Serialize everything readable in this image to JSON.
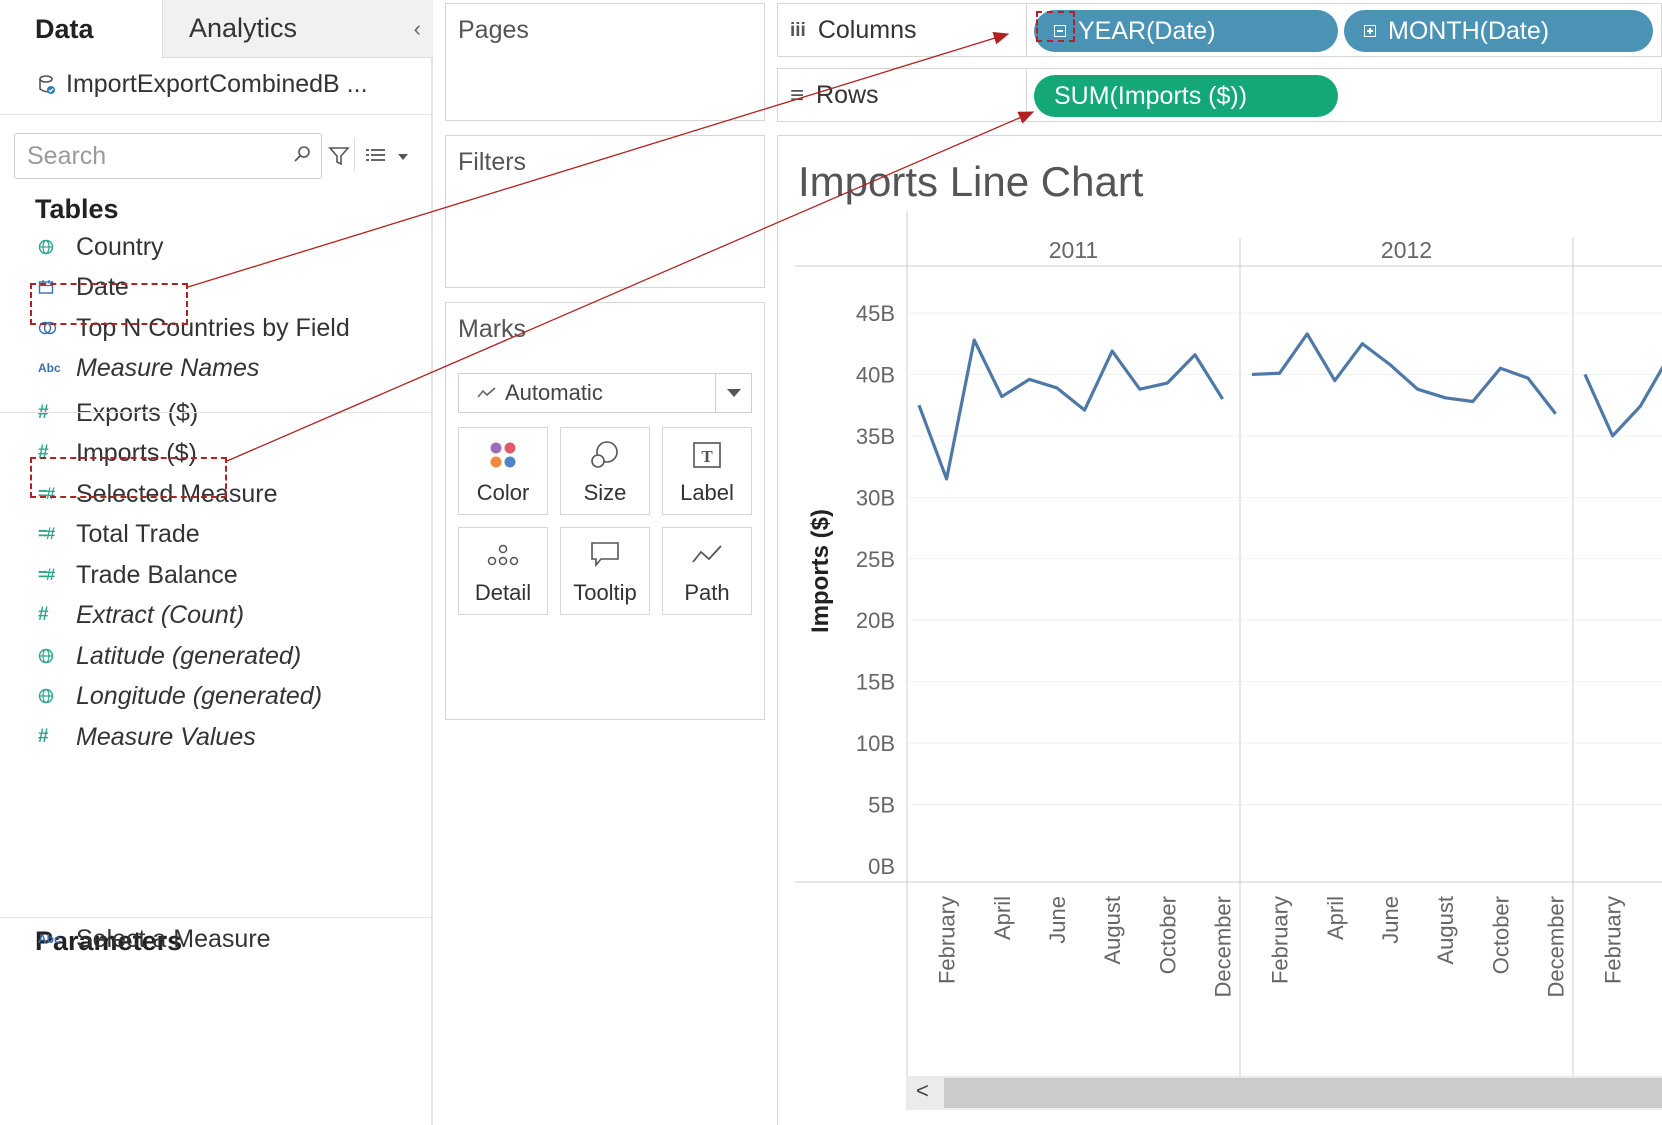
{
  "data_pane": {
    "tab_data": "Data",
    "tab_analytics": "Analytics",
    "collapse_glyph": "‹",
    "datasource": "ImportExportCombinedB ...",
    "search_placeholder": "Search",
    "tables_title": "Tables",
    "dimensions": [
      {
        "icon": "globe-icon",
        "label": "Country",
        "italic": false
      },
      {
        "icon": "calendar-icon",
        "label": "Date",
        "italic": false
      },
      {
        "icon": "set-icon",
        "label": "Top N Countries by Field",
        "italic": false
      },
      {
        "icon": "abc-icon",
        "label": "Measure Names",
        "italic": true
      }
    ],
    "measures": [
      {
        "icon": "hash-icon",
        "label": "Exports ($)",
        "italic": false
      },
      {
        "icon": "hash-icon",
        "label": "Imports ($)",
        "italic": false
      },
      {
        "icon": "calc-hash-icon",
        "label": "Selected Measure",
        "italic": false
      },
      {
        "icon": "calc-hash-icon",
        "label": "Total Trade",
        "italic": false
      },
      {
        "icon": "calc-hash-icon",
        "label": "Trade Balance",
        "italic": false
      },
      {
        "icon": "hash-icon",
        "label": "Extract (Count)",
        "italic": true
      },
      {
        "icon": "globe-icon",
        "label": "Latitude (generated)",
        "italic": true
      },
      {
        "icon": "globe-icon",
        "label": "Longitude (generated)",
        "italic": true
      },
      {
        "icon": "hash-icon",
        "label": "Measure Values",
        "italic": true
      }
    ],
    "parameters_title": "Parameters",
    "parameters": [
      {
        "icon": "abc-icon",
        "label": "Select a Measure"
      }
    ],
    "abc_glyph": "Abc",
    "hash_glyph": "#",
    "calc_hash_glyph": "=#"
  },
  "cards": {
    "pages_title": "Pages",
    "filters_title": "Filters",
    "marks_title": "Marks",
    "marks_type": "Automatic",
    "mark_buttons": [
      "Color",
      "Size",
      "Label",
      "Detail",
      "Tooltip",
      "Path"
    ]
  },
  "shelves": {
    "columns_label": "Columns",
    "rows_label": "Rows",
    "columns_pills": [
      "YEAR(Date)",
      "MONTH(Date)"
    ],
    "rows_pills": [
      "SUM(Imports ($))"
    ],
    "columns_icon": "iii",
    "rows_icon": "≡"
  },
  "colors": {
    "line": "#4e79a7",
    "pill_dimension": "#4a93b5",
    "pill_measure": "#14a777",
    "annotation": "#b22222"
  },
  "view": {
    "title": "Imports Line Chart",
    "scroll_left_glyph": "<"
  },
  "chart_data": {
    "type": "line",
    "title": "Imports Line Chart",
    "ylabel": "Imports ($)",
    "xlabel": "",
    "ylim": [
      0,
      48
    ],
    "y_ticks": [
      0,
      5,
      10,
      15,
      20,
      25,
      30,
      35,
      40,
      45
    ],
    "y_tick_labels": [
      "0B",
      "5B",
      "10B",
      "15B",
      "20B",
      "25B",
      "30B",
      "35B",
      "40B",
      "45B"
    ],
    "x_tick_labels": [
      "February",
      "April",
      "June",
      "August",
      "October",
      "December"
    ],
    "grid": true,
    "panels": [
      {
        "year": "2011",
        "months": 12,
        "values": [
          37.5,
          31.5,
          42.8,
          38.2,
          39.6,
          38.9,
          37.1,
          41.9,
          38.8,
          39.3,
          41.6,
          38.0
        ]
      },
      {
        "year": "2012",
        "months": 12,
        "values": [
          40.0,
          40.1,
          43.3,
          39.5,
          42.5,
          40.8,
          38.8,
          38.1,
          37.8,
          40.5,
          39.7,
          36.8
        ]
      },
      {
        "year": "",
        "months": 12,
        "values": [
          40.0,
          35.0,
          37.4,
          41.3
        ]
      }
    ],
    "series": [
      {
        "name": "",
        "unit": "B"
      }
    ]
  }
}
